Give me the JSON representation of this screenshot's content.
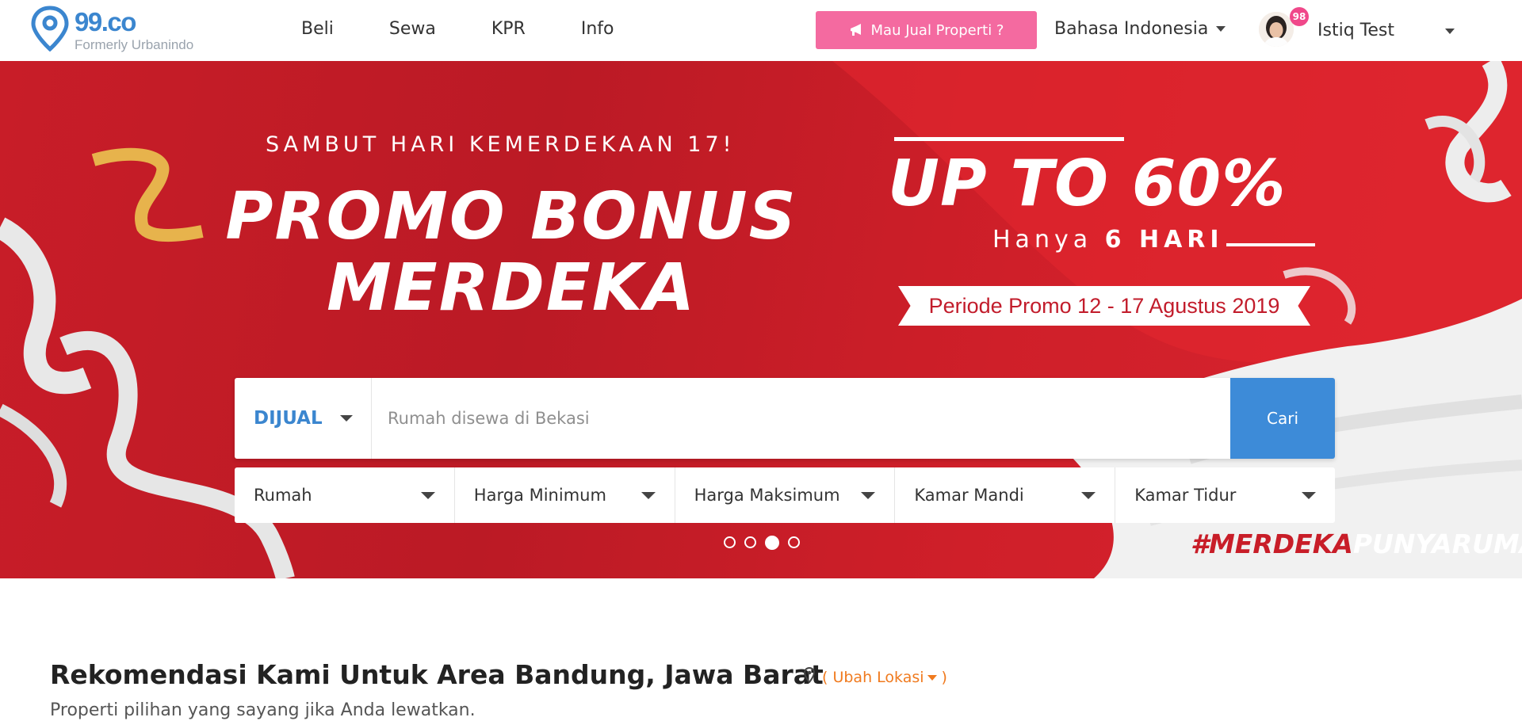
{
  "header": {
    "logo_text": "99.co",
    "logo_sub": "Formerly Urbanindo",
    "nav": [
      "Beli",
      "Sewa",
      "KPR",
      "Info"
    ],
    "sell_button": "Mau Jual Properti ?",
    "language": "Bahasa Indonesia",
    "notification_count": "98",
    "user_name": "Istiq Test"
  },
  "banner": {
    "sambut": "SAMBUT HARI KEMERDEKAAN 17!",
    "promo_line1": "PROMO BONUS",
    "promo_line2": "MERDEKA",
    "upto": "UP TO 60%",
    "hanya_prefix": "Hanya",
    "hanya_bold": "6 HARI",
    "periode": "Periode Promo 12 - 17 Agustus 2019",
    "hashtag_red": "#MERDEKA",
    "hashtag_white": "PUNYARUMA"
  },
  "search": {
    "type": "DIJUAL",
    "placeholder": "Rumah disewa di Bekasi",
    "button": "Cari",
    "filters": [
      "Rumah",
      "Harga Minimum",
      "Harga Maksimum",
      "Kamar Mandi",
      "Kamar Tidur"
    ]
  },
  "carousel": {
    "count": 4,
    "active": 3
  },
  "recommendation": {
    "title": "Rekomendasi Kami Untuk Area Bandung, Jawa Barat",
    "change_open": "(",
    "change_label": "Ubah Lokasi",
    "change_close": ")",
    "subtitle": "Properti pilihan yang sayang jika Anda lewatkan."
  },
  "colors": {
    "brand": "#3b86cf",
    "sell_button": "#f46aa0",
    "hero_red": "#c81d28",
    "search_button": "#3d8bd8",
    "link_orange": "#f07a1e"
  }
}
